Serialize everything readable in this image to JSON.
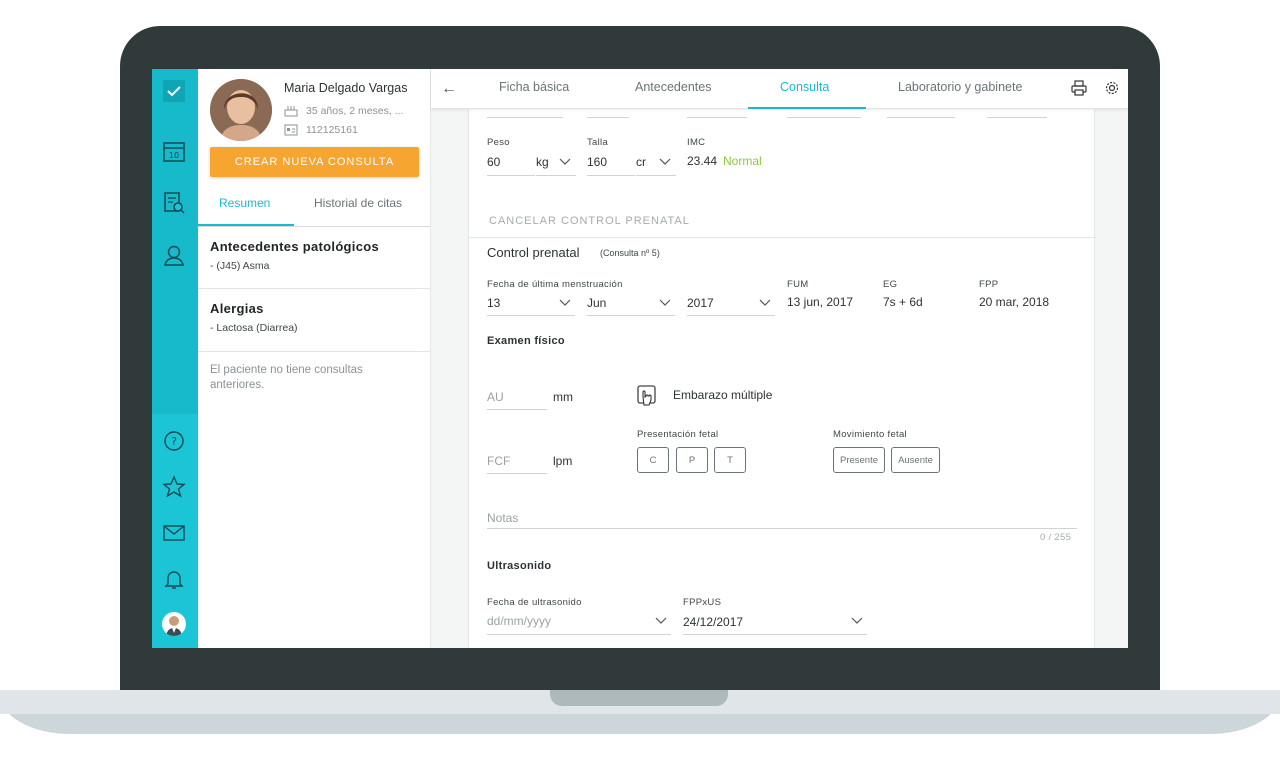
{
  "patient": {
    "name": "Maria Delgado Vargas",
    "age": "35 años, 2 meses, ...",
    "id": "112125161",
    "new_consult": "CREAR NUEVA CONSULTA",
    "tabs": [
      "Resumen",
      "Historial de citas"
    ],
    "sections": [
      {
        "title": "Antecedentes patológicos",
        "value": "- (J45) Asma"
      },
      {
        "title": "Alergias",
        "value": "- Lactosa (Diarrea)"
      }
    ],
    "no_history": "El paciente no tiene consultas anteriores."
  },
  "topbar": {
    "back": "←",
    "tabs": [
      "Ficha básica",
      "Antecedentes",
      "Consulta",
      "Laboratorio y gabinete"
    ],
    "active_tab": "Consulta"
  },
  "vitals": {
    "peso_label": "Peso",
    "peso_value": "60",
    "peso_unit": "kg",
    "talla_label": "Talla",
    "talla_value": "160",
    "talla_unit": "cr",
    "imc_label": "IMC",
    "imc_value": "23.44",
    "imc_status": "Normal"
  },
  "cancel_link": "CANCELAR CONTROL PRENATAL",
  "control": {
    "title": "Control prenatal",
    "subtitle": "(Consulta nº 5)",
    "fum_label": "Fecha de última menstruación",
    "day": "13",
    "month": "Jun",
    "year": "2017",
    "fum_col": "FUM",
    "fum_val": "13 jun, 2017",
    "eg_col": "EG",
    "eg_val": "7s + 6d",
    "fpp_col": "FPP",
    "fpp_val": "20 mar, 2018"
  },
  "exam": {
    "title": "Examen físico",
    "au_placeholder": "AU",
    "au_unit": "mm",
    "multiple_label": "Embarazo múltiple",
    "fcf_placeholder": "FCF",
    "fcf_unit": "lpm",
    "presentation_label": "Presentación fetal",
    "presentation_options": [
      "C",
      "P",
      "T"
    ],
    "movement_label": "Movimiento fetal",
    "movement_options": [
      "Presente",
      "Ausente"
    ],
    "notes_placeholder": "Notas",
    "notes_counter": "0 / 255"
  },
  "ultrasound": {
    "title": "Ultrasonido",
    "date_label": "Fecha de ultrasonido",
    "date_placeholder": "dd/mm/yyyy",
    "fppxus_label": "FPPxUS",
    "fppxus_value": "24/12/2017"
  },
  "colors": {
    "accent": "#1cb8cc",
    "orange": "#f6a531",
    "rail": "#1cc5d6",
    "normal": "#8cc63f"
  }
}
